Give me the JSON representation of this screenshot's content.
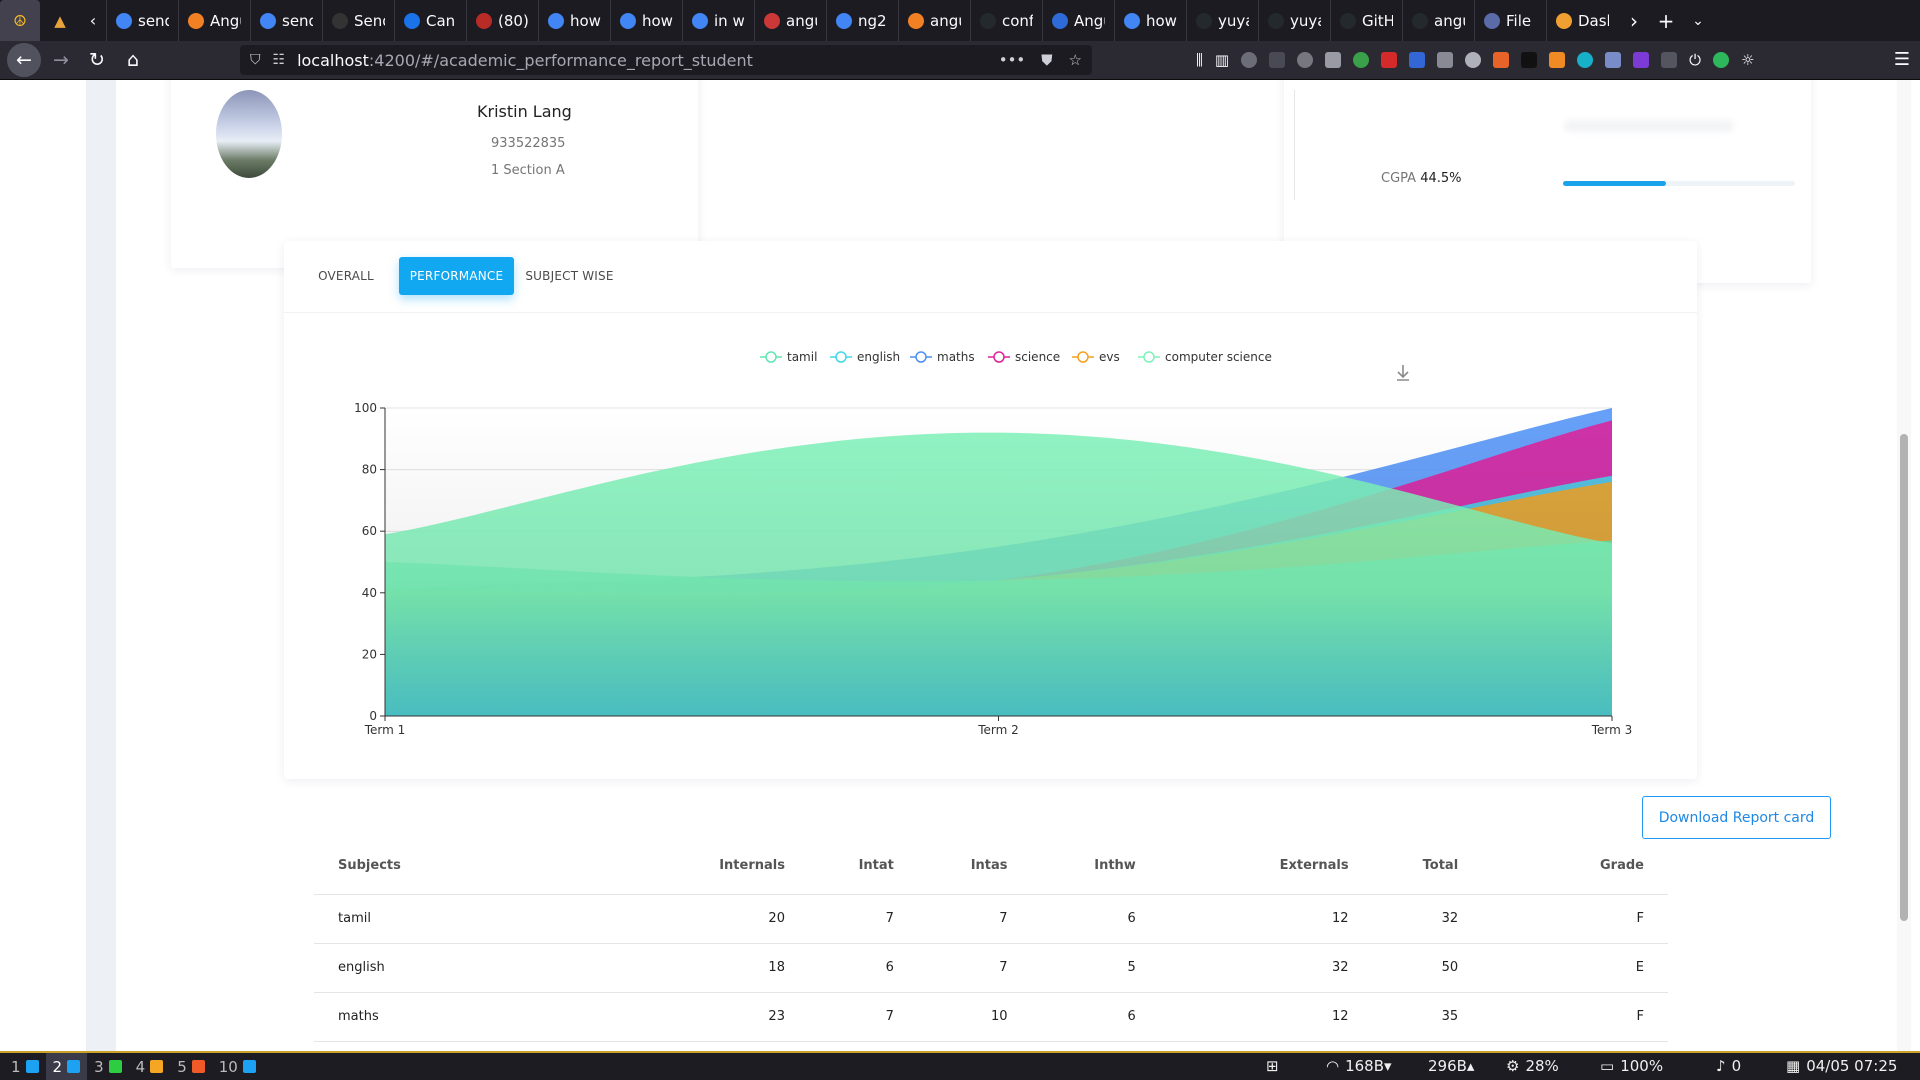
{
  "browser": {
    "pinned_tabs": [
      "pinned-tab-1",
      "pinned-tab-2"
    ],
    "tabs": [
      {
        "title": "send",
        "icon": "google-icon",
        "color": "#4285f4"
      },
      {
        "title": "Angu",
        "icon": "stackoverflow-icon",
        "color": "#f48024"
      },
      {
        "title": "send",
        "icon": "google-icon",
        "color": "#4285f4"
      },
      {
        "title": "Send",
        "icon": "dev-icon",
        "color": "#333333"
      },
      {
        "title": "Can",
        "icon": "bookmark-icon",
        "color": "#1a73e8"
      },
      {
        "title": "(80)",
        "icon": "quora-icon",
        "color": "#b92b27"
      },
      {
        "title": "how",
        "icon": "google-icon",
        "color": "#4285f4"
      },
      {
        "title": "how",
        "icon": "google-icon",
        "color": "#4285f4"
      },
      {
        "title": "in wi",
        "icon": "google-icon",
        "color": "#4285f4"
      },
      {
        "title": "angu",
        "icon": "npm-icon",
        "color": "#cb3837"
      },
      {
        "title": "ng2",
        "icon": "google-icon",
        "color": "#4285f4"
      },
      {
        "title": "angu",
        "icon": "stackoverflow-icon",
        "color": "#f48024"
      },
      {
        "title": "conf",
        "icon": "github-icon",
        "color": "#24292e"
      },
      {
        "title": "Angu",
        "icon": "bootstrap-icon",
        "color": "#2f6bd8"
      },
      {
        "title": "how",
        "icon": "google-icon",
        "color": "#4285f4"
      },
      {
        "title": "yuya",
        "icon": "github-icon",
        "color": "#24292e"
      },
      {
        "title": "yuya",
        "icon": "github-icon",
        "color": "#24292e"
      },
      {
        "title": "GitH",
        "icon": "github-icon",
        "color": "#24292e"
      },
      {
        "title": "angu",
        "icon": "github-icon",
        "color": "#24292e"
      },
      {
        "title": "File",
        "icon": "file-icon",
        "color": "#5a6ba8"
      },
      {
        "title": "Dasl",
        "icon": "dashboard-icon",
        "color": "#f0a030"
      }
    ],
    "url_host": "localhost",
    "url_path": ":4200/#/academic_performance_report_student"
  },
  "student": {
    "name": "Kristin Lang",
    "id": "933522835",
    "class": "1 Section A"
  },
  "cgpa": {
    "label": "CGPA",
    "value": "44.5%",
    "fraction": 0.445
  },
  "tabs": [
    {
      "label": "OVERALL",
      "active": false
    },
    {
      "label": "PERFORMANCE",
      "active": true
    },
    {
      "label": "SUBJECT WISE",
      "active": false
    }
  ],
  "chart_data": {
    "type": "area",
    "categories": [
      "Term 1",
      "Term 2",
      "Term 3"
    ],
    "ylim": [
      0,
      100
    ],
    "yticks": [
      0,
      20,
      40,
      60,
      80,
      100
    ],
    "grid": true,
    "legend_position": "top-center",
    "series": [
      {
        "name": "tamil",
        "values": [
          50,
          44,
          57
        ],
        "color": "#5ee6b4"
      },
      {
        "name": "english",
        "values": [
          42,
          44,
          78
        ],
        "color": "#40d8e8"
      },
      {
        "name": "maths",
        "values": [
          41,
          55,
          100
        ],
        "color": "#4c8ff7"
      },
      {
        "name": "science",
        "values": [
          41,
          44,
          96
        ],
        "color": "#e0209a"
      },
      {
        "name": "evs",
        "values": [
          41,
          44,
          76
        ],
        "color": "#f5a020"
      },
      {
        "name": "computer science",
        "values": [
          59,
          92,
          56
        ],
        "color": "#7ef2b8"
      }
    ]
  },
  "actions": {
    "download_report": "Download Report card"
  },
  "table": {
    "headers": [
      "Subjects",
      "Internals",
      "Intat",
      "Intas",
      "Inthw",
      "Externals",
      "Total",
      "Grade"
    ],
    "rows": [
      [
        "tamil",
        "20",
        "7",
        "7",
        "6",
        "12",
        "32",
        "F"
      ],
      [
        "english",
        "18",
        "6",
        "7",
        "5",
        "32",
        "50",
        "E"
      ],
      [
        "maths",
        "23",
        "7",
        "10",
        "6",
        "12",
        "35",
        "F"
      ]
    ]
  },
  "taskbar": {
    "workspaces": [
      {
        "num": "1",
        "color": "#1da1f2",
        "active": false
      },
      {
        "num": "2",
        "color": "#1da1f2",
        "active": true
      },
      {
        "num": "3",
        "color": "#2ecc40",
        "active": false
      },
      {
        "num": "4",
        "color": "#f5a623",
        "active": false
      },
      {
        "num": "5",
        "color": "#f05a28",
        "active": false
      },
      {
        "num": "10",
        "color": "#1da1f2",
        "active": false
      }
    ],
    "net_down": "168B▾",
    "net_up": "296B▴",
    "cpu": "28%",
    "battery": "100%",
    "notifications": "0",
    "datetime": "04/05 07:25"
  }
}
